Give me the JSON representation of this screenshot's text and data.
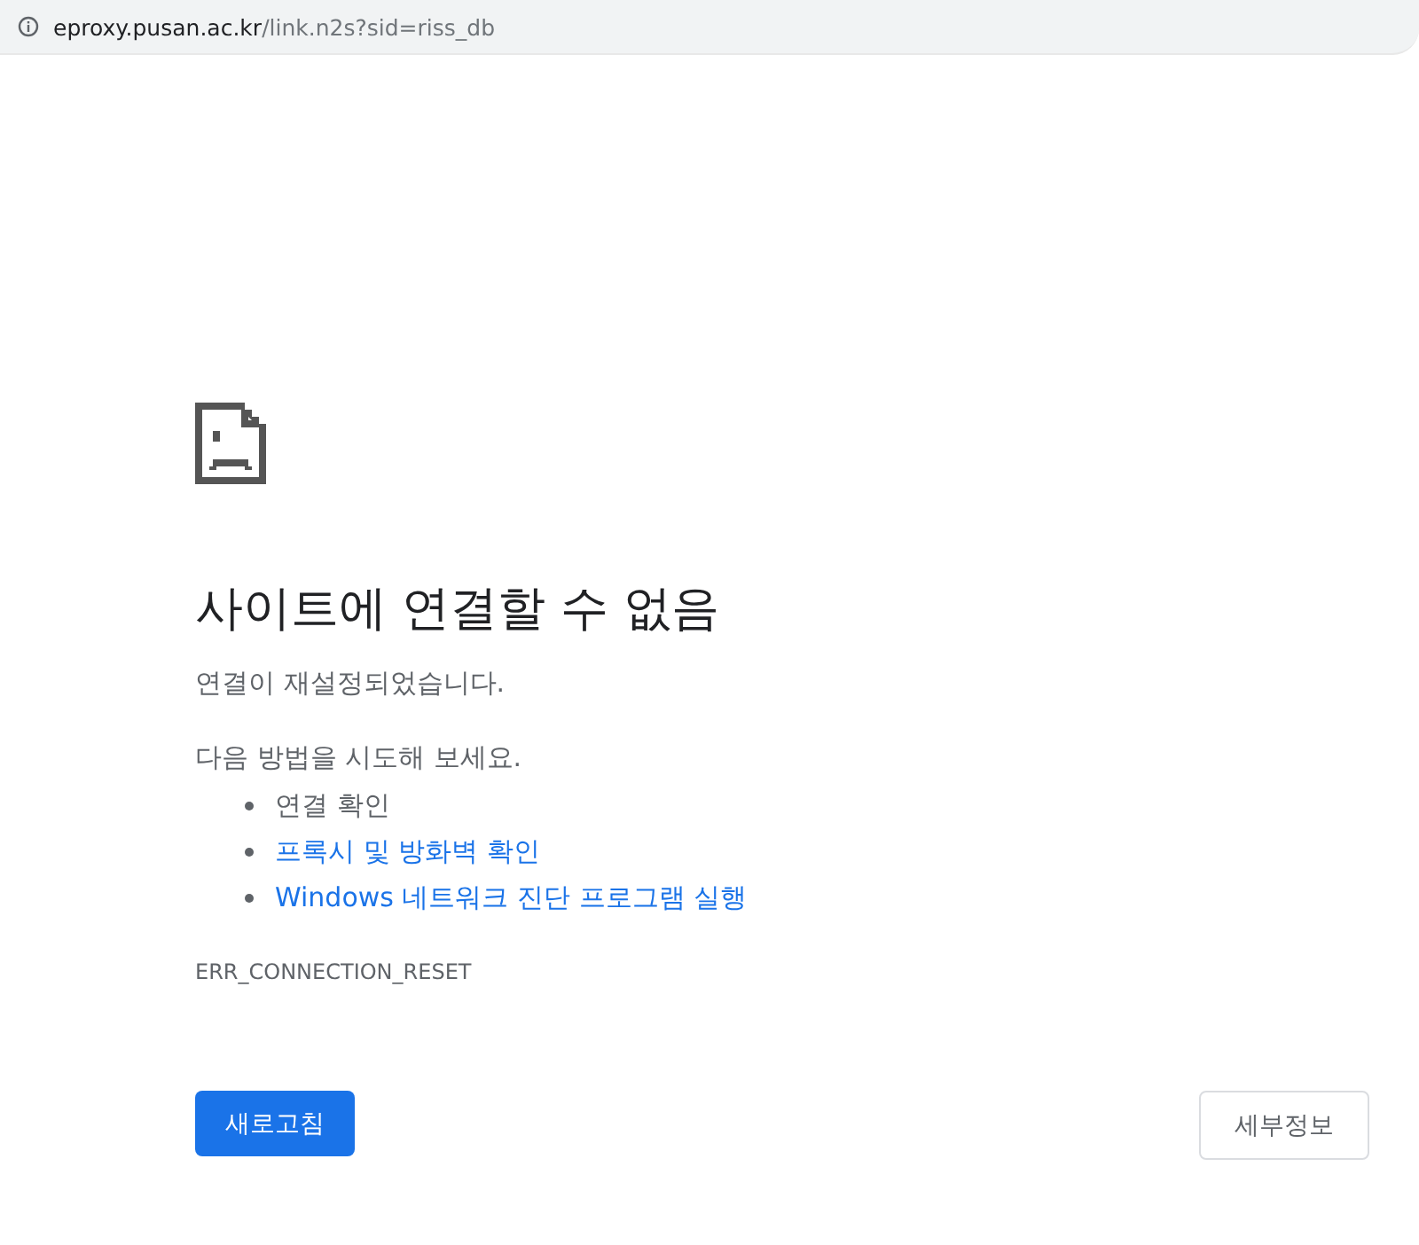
{
  "address_bar": {
    "host": "eproxy.pusan.ac.kr",
    "path": "/link.n2s?sid=riss_db"
  },
  "error": {
    "heading": "사이트에 연결할 수 없음",
    "message": "연결이 재설정되었습니다.",
    "try_label": "다음 방법을 시도해 보세요.",
    "suggestions": [
      {
        "kind": "text",
        "label": "연결 확인"
      },
      {
        "kind": "link",
        "label": "프록시 및 방화벽 확인"
      },
      {
        "kind": "link",
        "label": "Windows 네트워크 진단 프로그램 실행"
      }
    ],
    "code": "ERR_CONNECTION_RESET"
  },
  "buttons": {
    "reload": "새로고침",
    "details": "세부정보"
  }
}
